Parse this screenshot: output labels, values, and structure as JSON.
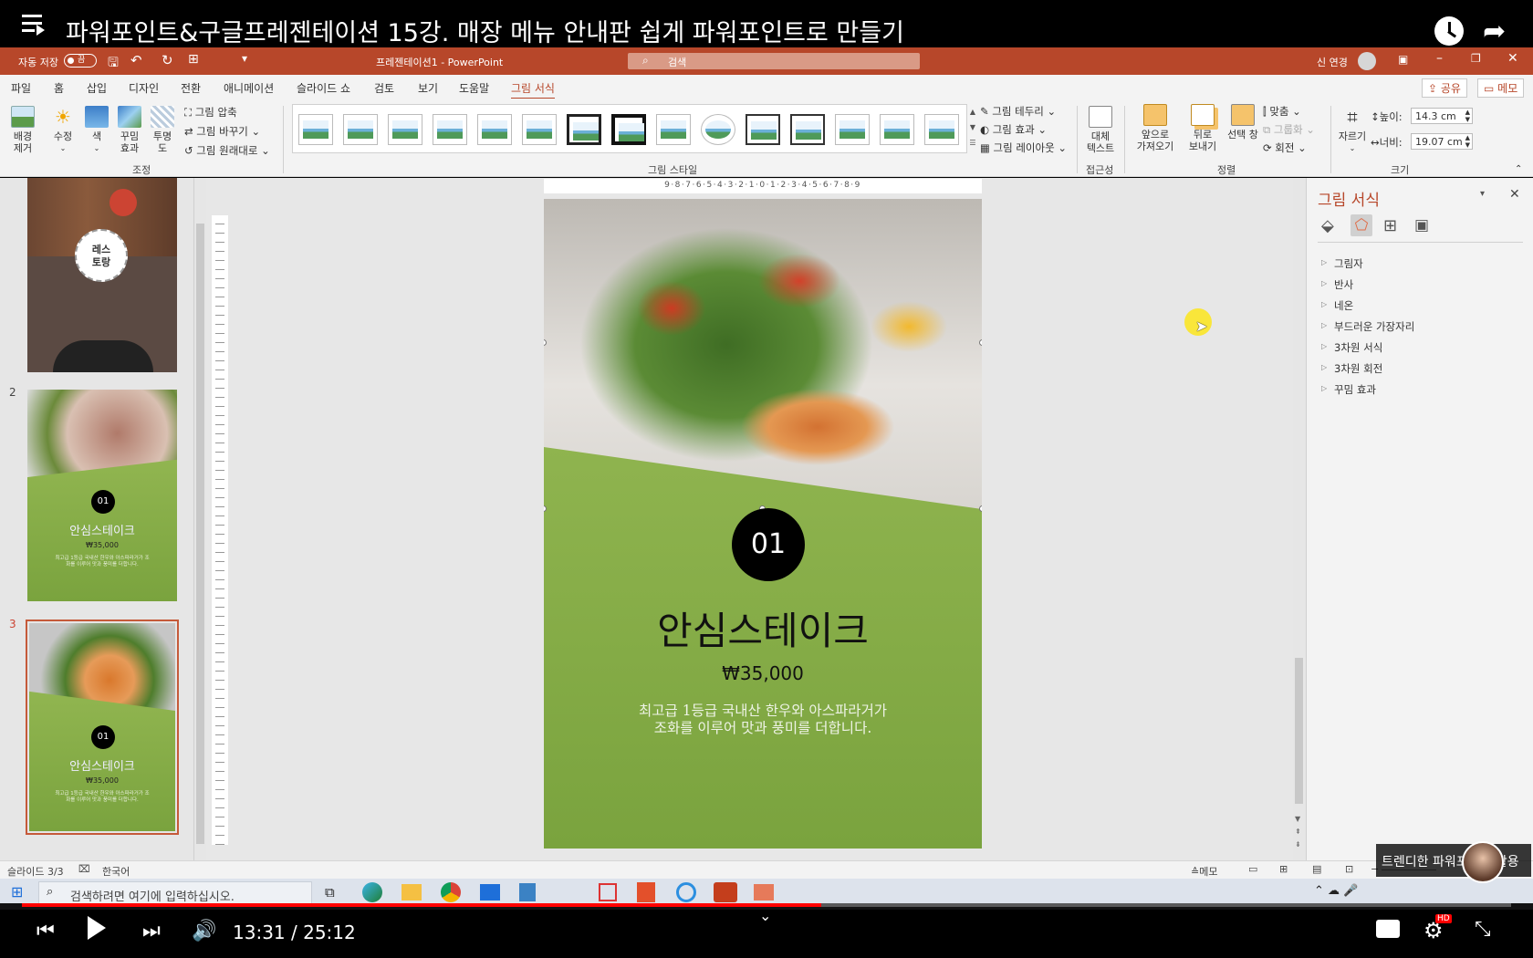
{
  "youtube": {
    "video_title": "파워포인트&구글프레젠테이션 15강. 매장 메뉴 안내판 쉽게 파워포인트로 만들기",
    "time_current": "13:31",
    "time_total": "25:12",
    "time_sep": " / ",
    "progress": 0.537,
    "hd_badge": "HD",
    "channel_watermark": "트렌디한 파워포인트 활용"
  },
  "titlebar": {
    "autosave_label": "자동 저장",
    "autosave_state": "끔",
    "doc_title": "프레젠테이션1  -  PowerPoint",
    "search_placeholder": "검색",
    "user_name": "신 연경"
  },
  "tabs": [
    "파일",
    "홈",
    "삽입",
    "디자인",
    "전환",
    "애니메이션",
    "슬라이드 쇼",
    "검토",
    "보기",
    "도움말",
    "그림 서식"
  ],
  "active_tab": "그림 서식",
  "share_label": "공유",
  "comments_label": "메모",
  "ribbon": {
    "remove_bg": "배경\n제거",
    "corrections": "수정",
    "color": "색",
    "artistic": "꾸밈\n효과",
    "transparency": "투명\n도",
    "compress": "그림 압축",
    "change_picture": "그림 바꾸기",
    "reset_picture": "그림 원래대로",
    "group_adjust": "조정",
    "group_styles": "그림 스타일",
    "border": "그림 테두리",
    "effects": "그림 효과",
    "layout": "그림 레이아웃",
    "alt_text": "대체\n텍스트",
    "group_access": "접근성",
    "bring_forward": "앞으로\n가져오기",
    "send_backward": "뒤로\n보내기",
    "selection_pane": "선택 창",
    "align": "맞춤",
    "group": "그룹화",
    "rotate": "회전",
    "group_arrange": "정렬",
    "crop": "자르기",
    "height_label": "높이:",
    "height_value": "14.3 cm",
    "width_label": "너비:",
    "width_value": "19.07 cm",
    "group_size": "크기"
  },
  "slides_pane": {
    "slide1_circle": "레스\n토랑",
    "slide2_number": "2",
    "slide3_number": "3",
    "thumb_badge": "01",
    "thumb_title": "안심스테이크",
    "thumb_price": "₩35,000",
    "thumb_desc": "최고급 1등급 국내산 한우와 아스파라거가 조화를 이루어 맛과 풍미를 더합니다."
  },
  "slide": {
    "badge": "01",
    "title": "안심스테이크",
    "price": "₩35,000",
    "desc_line1": "최고급 1등급 국내산 한우와 아스파라거가",
    "desc_line2": "조화를 이루어 맛과 풍미를 더합니다."
  },
  "ruler_labels": "9·8·7·6·5·4·3·2·1·0·1·2·3·4·5·6·7·8·9",
  "format_pane": {
    "title": "그림 서식",
    "sections": [
      "그림자",
      "반사",
      "네온",
      "부드러운 가장자리",
      "3차원 서식",
      "3차원 회전",
      "꾸밈 효과"
    ]
  },
  "statusbar": {
    "slide_info": "슬라이드 3/3",
    "language": "한국어",
    "notes": "메모"
  },
  "taskbar": {
    "search_placeholder": "검색하려면 여기에 입력하십시오."
  },
  "colors": {
    "ppt_accent": "#b7472a",
    "slide_green": "#8cb24a",
    "yt_red": "#ff0000"
  }
}
